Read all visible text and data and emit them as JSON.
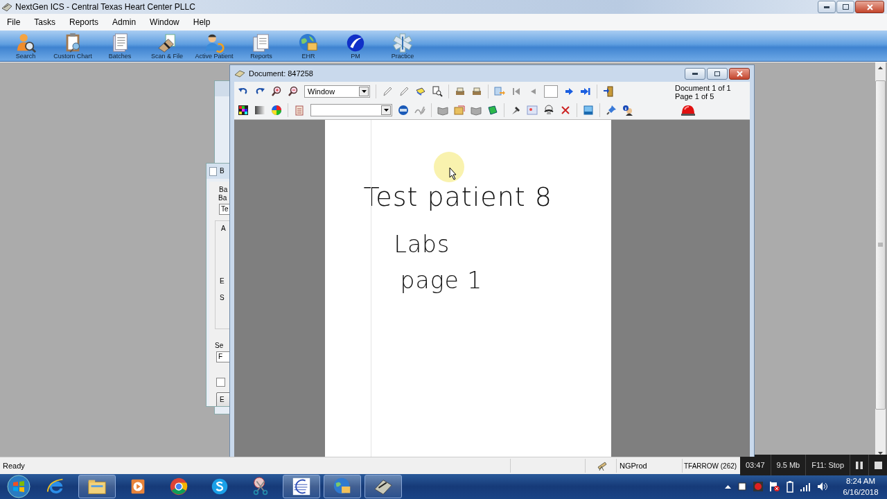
{
  "window": {
    "title": "NextGen ICS - Central Texas Heart Center PLLC"
  },
  "menu": [
    "File",
    "Tasks",
    "Reports",
    "Admin",
    "Window",
    "Help"
  ],
  "toolbar": [
    {
      "kind": "search",
      "label": "Search"
    },
    {
      "kind": "chart",
      "label": "Custom Chart"
    },
    {
      "kind": "batches",
      "label": "Batches"
    },
    {
      "kind": "scan",
      "label": "Scan & File"
    },
    {
      "kind": "patient",
      "label": "Active Patient"
    },
    {
      "kind": "reports",
      "label": "Reports"
    },
    {
      "kind": "ehr",
      "label": "EHR"
    },
    {
      "kind": "pm",
      "label": "PM"
    },
    {
      "kind": "practice",
      "label": "Practice"
    }
  ],
  "batch_window": {
    "title": "B",
    "group": "Ba",
    "label": "Ba",
    "field_value": "Te",
    "inner_group": "A",
    "line_1": "E",
    "line_2": "S",
    "section": "Se",
    "dropdown_value": "F",
    "checked": false,
    "button": "E"
  },
  "document_window": {
    "title": "Document: 847258",
    "zoom_mode": "Window",
    "document_count": "Document 1 of 1",
    "page_count": "Page 1 of 5",
    "page_lines": [
      "Test patient 8",
      "Labs",
      "page 1"
    ]
  },
  "status_bar": {
    "text": "Ready",
    "database": "NGProd",
    "user": "TFARROW (262)"
  },
  "recorder": {
    "elapsed": "03:47",
    "size": "9.5 Mb",
    "stop_hint": "F11: Stop"
  },
  "taskbar": {
    "apps": [
      {
        "kind": "ie",
        "running": false
      },
      {
        "kind": "explorer",
        "running": true
      },
      {
        "kind": "media",
        "running": false
      },
      {
        "kind": "chrome",
        "running": false
      },
      {
        "kind": "skype",
        "running": false
      },
      {
        "kind": "snipping",
        "running": false
      },
      {
        "kind": "ics",
        "running": true
      },
      {
        "kind": "ehr",
        "running": true
      },
      {
        "kind": "scanner",
        "running": true
      }
    ],
    "clock_time": "8:24 AM",
    "clock_date": "6/16/2018"
  }
}
